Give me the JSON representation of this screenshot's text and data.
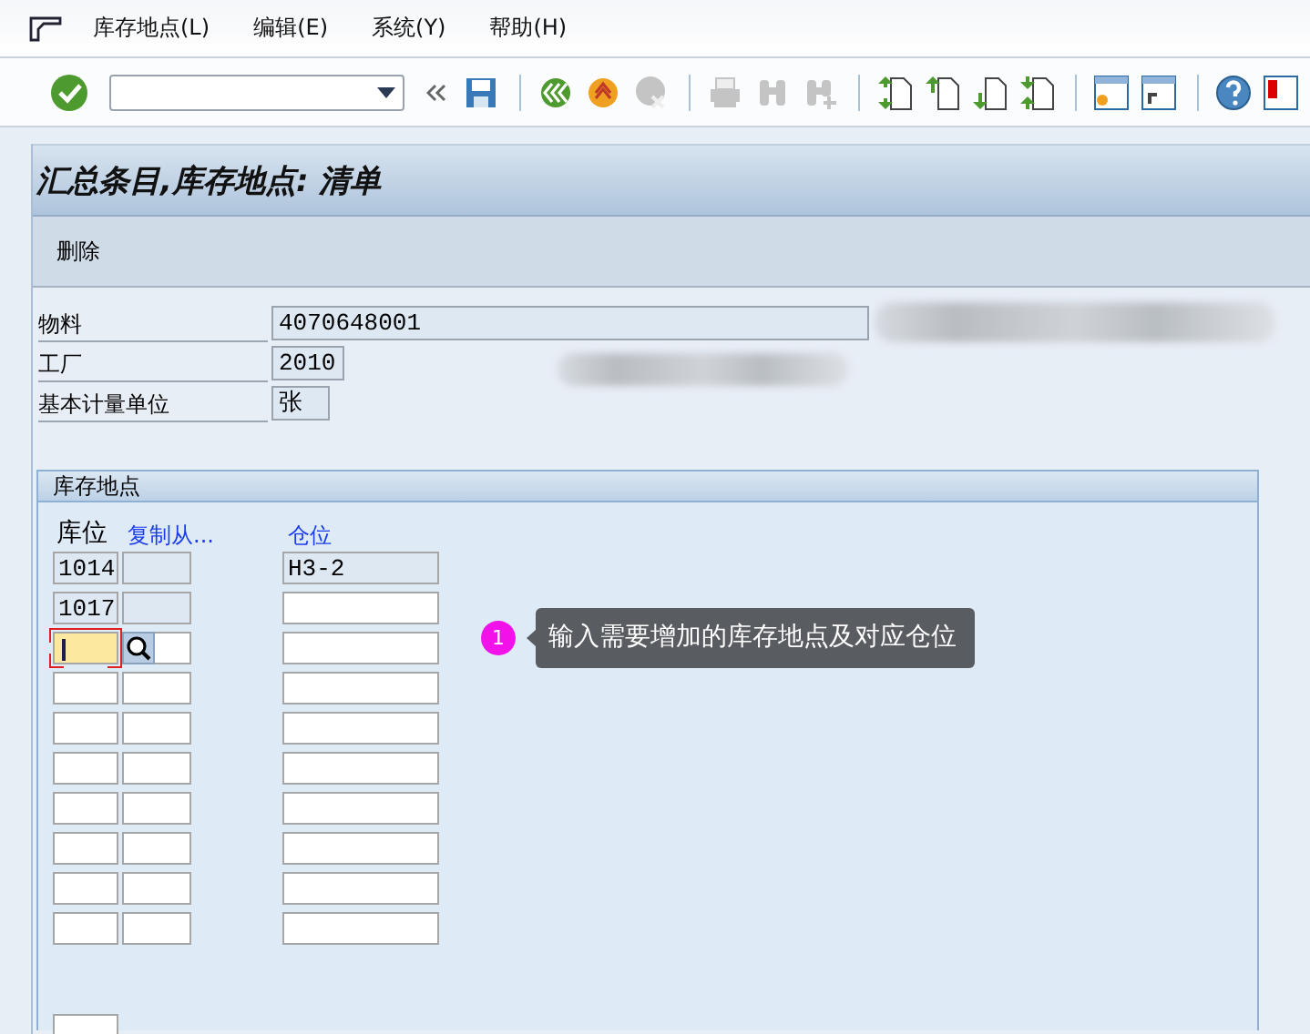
{
  "menu": [
    {
      "label": "库存地点(L)"
    },
    {
      "label": "编辑(E)"
    },
    {
      "label": "系统(Y)"
    },
    {
      "label": "帮助(H)"
    }
  ],
  "toolbar": {
    "groups": [
      [
        {
          "kind": "save",
          "disabled": false
        }
      ],
      [
        {
          "kind": "back",
          "disabled": false
        },
        {
          "kind": "exit",
          "disabled": false
        },
        {
          "kind": "cancel",
          "disabled": true
        }
      ],
      [
        {
          "kind": "print",
          "disabled": true
        },
        {
          "kind": "find",
          "disabled": true
        },
        {
          "kind": "find-next",
          "disabled": true
        }
      ],
      [
        {
          "kind": "first-page",
          "disabled": false
        },
        {
          "kind": "previous-page",
          "disabled": false
        },
        {
          "kind": "next-page",
          "disabled": false
        },
        {
          "kind": "last-page",
          "disabled": false
        }
      ],
      [
        {
          "kind": "new-session",
          "disabled": false
        },
        {
          "kind": "shortcut",
          "disabled": false
        }
      ],
      [
        {
          "kind": "help",
          "disabled": false
        },
        {
          "kind": "layout",
          "disabled": false
        }
      ]
    ]
  },
  "title": "汇总条目,库存地点: 清单",
  "app_toolbar": [
    {
      "label": "删除"
    }
  ],
  "header_fields": [
    {
      "label": "物料",
      "value": "4070648001"
    },
    {
      "label": "工厂",
      "value": "2010"
    },
    {
      "label": "基本计量单位",
      "value": "张"
    }
  ],
  "storage_locations": {
    "title": "库存地点",
    "columns": [
      {
        "label": "库位",
        "link": false
      },
      {
        "label": "复制从...",
        "link": true
      },
      {
        "label": "仓位",
        "link": true
      }
    ],
    "rows": [
      {
        "location": "1014",
        "bin": "H3-2",
        "readonly": true,
        "bin_readonly": true,
        "focused": false
      },
      {
        "location": "1017",
        "readonly": true,
        "bin_readonly": false,
        "focused": false
      },
      {
        "readonly": false,
        "bin_readonly": false,
        "focused": true
      },
      {
        "readonly": false,
        "bin_readonly": false,
        "focused": false
      },
      {
        "readonly": false,
        "bin_readonly": false,
        "focused": false
      },
      {
        "readonly": false,
        "bin_readonly": false,
        "focused": false
      },
      {
        "readonly": false,
        "bin_readonly": false,
        "focused": false
      },
      {
        "readonly": false,
        "bin_readonly": false,
        "focused": false
      },
      {
        "readonly": false,
        "bin_readonly": false,
        "focused": false
      },
      {
        "readonly": false,
        "bin_readonly": false,
        "focused": false
      }
    ]
  },
  "annotation": {
    "number": "1",
    "text": "输入需要增加的库存地点及对应仓位"
  }
}
